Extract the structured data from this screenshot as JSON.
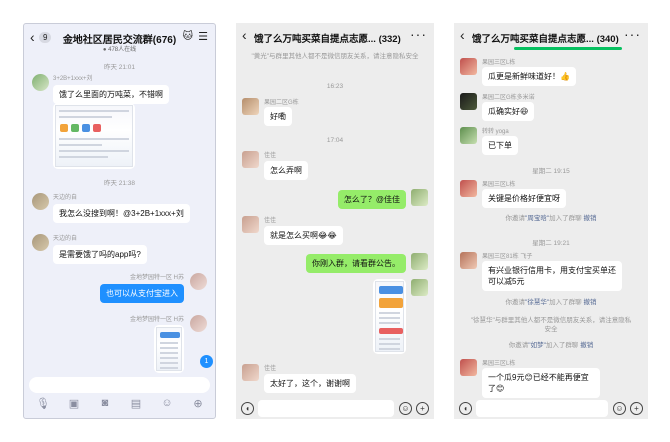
{
  "colors": {
    "qq_bubble": "#1f90ff",
    "wechat_bubble": "#95ec69",
    "link": "#576b95"
  },
  "p1": {
    "badge": "9",
    "title": "金地社区居民交流群(676)",
    "subtitle": "● 478人在线",
    "ts1": "昨天 21:01",
    "m1_name": "3+2B+1xxx+刘",
    "m1_text": "饿了么里面的万吨菜，不错啊",
    "ts2": "昨天 21:38",
    "m2_name": "天边的自",
    "m2_text": "我怎么没搜到啊！@3+2B+1xxx+刘",
    "m3_name": "天边的自",
    "m3_text": "是需要饿了吗的app吗?",
    "m4_name": "金地梦园特一区 H苏",
    "m4_text": "也可以从支付宝进入",
    "m5_name": "金地梦园特一区 H苏",
    "float_badge": "1"
  },
  "p2": {
    "title": "饿了么万吨买菜自提点志愿...",
    "count": "(332)",
    "sys1": "\"黄光\"与群里其他人都不是微信朋友关系，请注意隐私安全",
    "ts1": "16:23",
    "m1_name": "果园二区G栋",
    "m1_text": "好嘞",
    "ts2": "17:04",
    "m2_name": "佳佳",
    "m2_text": "怎么弄啊",
    "m3_text": "怎么了？@佳佳",
    "m4_name": "佳佳",
    "m4_text": "就是怎么买啊😂😂",
    "m5_text": "你刚入群，请看群公告。",
    "m6_name": "佳佳",
    "m6_text": "太好了，这个，谢谢啊"
  },
  "p3": {
    "title": "饿了么万吨买菜自提点志愿...",
    "count": "(340)",
    "m1_name": "果园三区L栋",
    "m1_text": "瓜更是新鲜味道好！👍",
    "m2_name": "果园二区G栋多米诺",
    "m2_text": "瓜确实好😆",
    "m3_name": "转转 yoga",
    "m3_text": "已下单",
    "ts1": "星期二 19:15",
    "m4_name": "果园三区L栋",
    "m4_text": "关键是价格好便宜呀",
    "sys1_pre": "你邀请",
    "sys1_who": "\"周宝晗\"",
    "sys1_post": "加入了群聊",
    "sys1_act": "撤销",
    "ts2": "星期二 19:21",
    "m5_name": "果园三区81栋 飞子",
    "m5_text": "有兴业银行信用卡，用支付宝买单还可以减5元",
    "sys2_pre": "你邀请",
    "sys2_who": "\"徐慧华\"",
    "sys2_post": "加入了群聊",
    "sys2_act": "撤销",
    "sys3": "\"徐慧华\"与群里其他人都不是微信朋友关系，请注意隐私安全",
    "sys4_pre": "你邀请",
    "sys4_who": "\"如梦\"",
    "sys4_post": "加入了群聊",
    "sys4_act": "撤销",
    "m6_name": "果园三区L栋",
    "m6_text": "一个瓜9元😊已经不能再便宜了😊"
  }
}
